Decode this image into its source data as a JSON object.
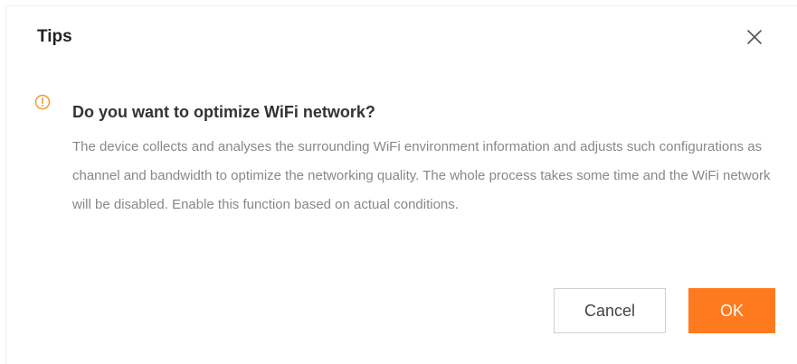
{
  "dialog": {
    "title": "Tips",
    "heading": "Do you want to optimize WiFi network?",
    "body": "The device collects and analyses the surrounding WiFi environment information and adjusts such configurations as channel and bandwidth to optimize the networking quality. The whole process takes some time and the WiFi network will be disabled. Enable this function based on actual conditions.",
    "cancel_label": "Cancel",
    "ok_label": "OK",
    "icons": {
      "close": "close-icon",
      "warning": "exclamation-circle-icon"
    },
    "colors": {
      "accent": "#ff7a1f",
      "warning": "#f39a37",
      "body_text": "#888888"
    }
  }
}
